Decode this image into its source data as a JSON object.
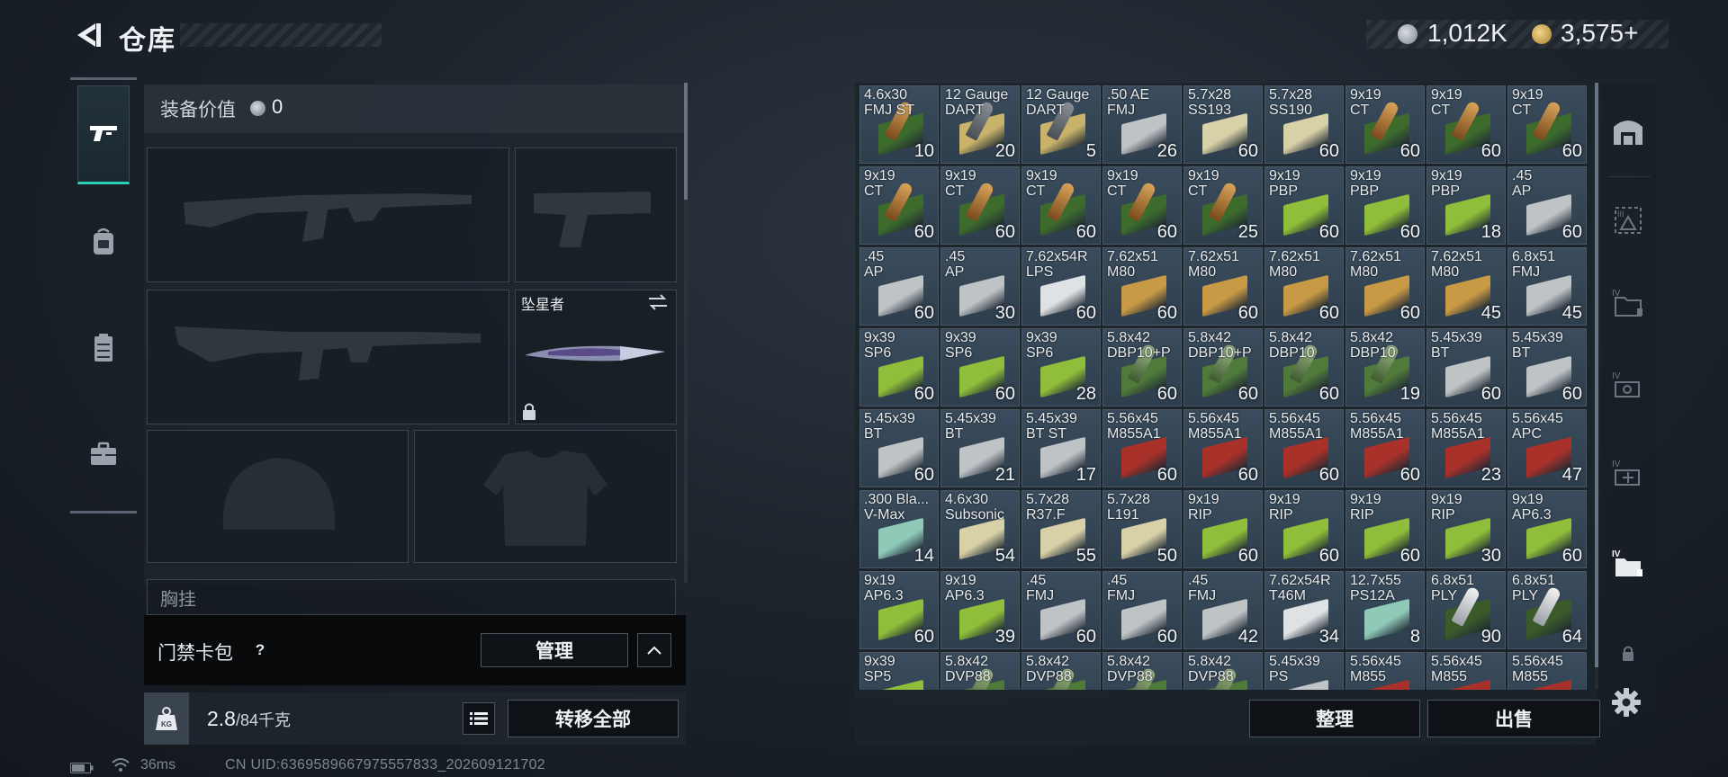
{
  "header": {
    "title": "仓库",
    "currency1": "1,012K",
    "currency2": "3,575+"
  },
  "equipment": {
    "value_label": "装备价值",
    "value": "0",
    "melee_name": "坠星者",
    "chest_label": "胸挂"
  },
  "card_bar": {
    "label": "门禁卡包",
    "help": "?",
    "manage_label": "管理"
  },
  "weight": {
    "current": "2.8",
    "max": "/84千克",
    "transfer_all_label": "转移全部"
  },
  "status": {
    "ping": "36ms",
    "uid": "CN UID:6369589667975557833_202609121702"
  },
  "inventory": {
    "sort_label": "整理",
    "sell_label": "出售",
    "items": [
      {
        "name": "4.6x30\nFMJ ST",
        "count": "10",
        "style": "b"
      },
      {
        "name": "12 Gauge\nDART",
        "count": "20",
        "style": "g"
      },
      {
        "name": "12 Gauge\nDART",
        "count": "5",
        "style": "g"
      },
      {
        "name": ".50 AE\nFMJ",
        "count": "26",
        "style": "s"
      },
      {
        "name": "5.7x28\nSS193",
        "count": "60",
        "style": "t"
      },
      {
        "name": "5.7x28\nSS190",
        "count": "60",
        "style": "t"
      },
      {
        "name": "9x19\nCT",
        "count": "60",
        "style": "b"
      },
      {
        "name": "9x19\nCT",
        "count": "60",
        "style": "b"
      },
      {
        "name": "9x19\nCT",
        "count": "60",
        "style": "b"
      },
      {
        "name": "9x19\nCT",
        "count": "60",
        "style": "b"
      },
      {
        "name": "9x19\nCT",
        "count": "60",
        "style": "b"
      },
      {
        "name": "9x19\nCT",
        "count": "60",
        "style": "b"
      },
      {
        "name": "9x19\nCT",
        "count": "60",
        "style": "b"
      },
      {
        "name": "9x19\nCT",
        "count": "25",
        "style": "b"
      },
      {
        "name": "9x19\nPBP",
        "count": "60",
        "style": "l"
      },
      {
        "name": "9x19\nPBP",
        "count": "60",
        "style": "l"
      },
      {
        "name": "9x19\nPBP",
        "count": "18",
        "style": "l"
      },
      {
        "name": ".45\nAP",
        "count": "60",
        "style": "s"
      },
      {
        "name": ".45\nAP",
        "count": "60",
        "style": "s"
      },
      {
        "name": ".45\nAP",
        "count": "30",
        "style": "s"
      },
      {
        "name": "7.62x54R\nLPS",
        "count": "60",
        "style": "w"
      },
      {
        "name": "7.62x51\nM80",
        "count": "60",
        "style": "y"
      },
      {
        "name": "7.62x51\nM80",
        "count": "60",
        "style": "y"
      },
      {
        "name": "7.62x51\nM80",
        "count": "60",
        "style": "y"
      },
      {
        "name": "7.62x51\nM80",
        "count": "60",
        "style": "y"
      },
      {
        "name": "7.62x51\nM80",
        "count": "45",
        "style": "y"
      },
      {
        "name": "6.8x51\nFMJ",
        "count": "45",
        "style": "s"
      },
      {
        "name": "9x39\nSP6",
        "count": "60",
        "style": "l"
      },
      {
        "name": "9x39\nSP6",
        "count": "60",
        "style": "l"
      },
      {
        "name": "9x39\nSP6",
        "count": "28",
        "style": "l"
      },
      {
        "name": "5.8x42\nDBP10+P",
        "count": "60",
        "style": "d"
      },
      {
        "name": "5.8x42\nDBP10+P",
        "count": "60",
        "style": "d"
      },
      {
        "name": "5.8x42\nDBP10",
        "count": "60",
        "style": "d"
      },
      {
        "name": "5.8x42\nDBP10",
        "count": "19",
        "style": "d"
      },
      {
        "name": "5.45x39\nBT",
        "count": "60",
        "style": "s"
      },
      {
        "name": "5.45x39\nBT",
        "count": "60",
        "style": "s"
      },
      {
        "name": "5.45x39\nBT",
        "count": "60",
        "style": "s"
      },
      {
        "name": "5.45x39\nBT",
        "count": "21",
        "style": "s"
      },
      {
        "name": "5.45x39\nBT ST",
        "count": "17",
        "style": "s"
      },
      {
        "name": "5.56x45\nM855A1",
        "count": "60",
        "style": "r"
      },
      {
        "name": "5.56x45\nM855A1",
        "count": "60",
        "style": "r"
      },
      {
        "name": "5.56x45\nM855A1",
        "count": "60",
        "style": "r"
      },
      {
        "name": "5.56x45\nM855A1",
        "count": "60",
        "style": "r"
      },
      {
        "name": "5.56x45\nM855A1",
        "count": "23",
        "style": "r"
      },
      {
        "name": "5.56x45\nAPC",
        "count": "47",
        "style": "r"
      },
      {
        "name": ".300 Bla...\nV-Max",
        "count": "14",
        "style": "c"
      },
      {
        "name": "4.6x30\nSubsonic",
        "count": "54",
        "style": "t"
      },
      {
        "name": "5.7x28\nR37.F",
        "count": "55",
        "style": "t"
      },
      {
        "name": "5.7x28\nL191",
        "count": "50",
        "style": "t"
      },
      {
        "name": "9x19\nRIP",
        "count": "60",
        "style": "l"
      },
      {
        "name": "9x19\nRIP",
        "count": "60",
        "style": "l"
      },
      {
        "name": "9x19\nRIP",
        "count": "60",
        "style": "l"
      },
      {
        "name": "9x19\nRIP",
        "count": "30",
        "style": "l"
      },
      {
        "name": "9x19\nAP6.3",
        "count": "60",
        "style": "l"
      },
      {
        "name": "9x19\nAP6.3",
        "count": "60",
        "style": "l"
      },
      {
        "name": "9x19\nAP6.3",
        "count": "39",
        "style": "l"
      },
      {
        "name": ".45\nFMJ",
        "count": "60",
        "style": "s"
      },
      {
        "name": ".45\nFMJ",
        "count": "60",
        "style": "s"
      },
      {
        "name": ".45\nFMJ",
        "count": "42",
        "style": "s"
      },
      {
        "name": "7.62x54R\nT46M",
        "count": "34",
        "style": "w"
      },
      {
        "name": "12.7x55\nPS12A",
        "count": "8",
        "style": "c"
      },
      {
        "name": "6.8x51\nPLY",
        "count": "90",
        "style": "p"
      },
      {
        "name": "6.8x51\nPLY",
        "count": "64",
        "style": "p"
      },
      {
        "name": "9x39\nSP5",
        "count": "",
        "style": "l"
      },
      {
        "name": "5.8x42\nDVP88",
        "count": "",
        "style": "d"
      },
      {
        "name": "5.8x42\nDVP88",
        "count": "",
        "style": "d"
      },
      {
        "name": "5.8x42\nDVP88",
        "count": "",
        "style": "d"
      },
      {
        "name": "5.8x42\nDVP88",
        "count": "",
        "style": "d"
      },
      {
        "name": "5.45x39\nPS",
        "count": "",
        "style": "s"
      },
      {
        "name": "5.56x45\nM855",
        "count": "",
        "style": "r"
      },
      {
        "name": "5.56x45\nM855",
        "count": "",
        "style": "r"
      },
      {
        "name": "5.56x45\nM855",
        "count": "",
        "style": "r"
      }
    ]
  },
  "icons": {
    "back": "back-arrow-icon",
    "settings": "gear-icon"
  },
  "colors": {
    "accent": "#2ad0b3",
    "currency_gold": "#c9a24a"
  }
}
